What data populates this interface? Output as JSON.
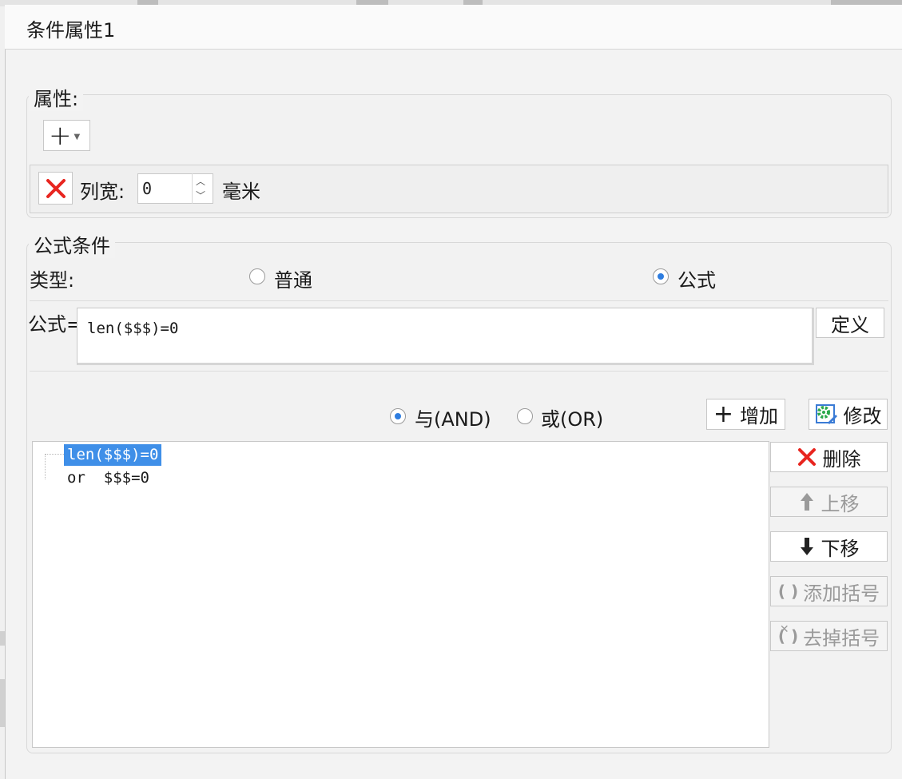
{
  "dialog": {
    "title": "条件属性1"
  },
  "property_group": {
    "legend": "属性:",
    "add_button": "+",
    "column_width_label": "列宽:",
    "column_width_value": "0",
    "unit": "毫米"
  },
  "formula_group": {
    "legend": "公式条件",
    "type_label": "类型:",
    "type_options": [
      {
        "label": "普通",
        "selected": false
      },
      {
        "label": "公式",
        "selected": true
      }
    ],
    "formula_label": "公式=",
    "formula_value": "len($$$)=0",
    "define_button": "定义",
    "logic_options": [
      {
        "label": "与(AND)",
        "selected": true
      },
      {
        "label": "或(OR)",
        "selected": false
      }
    ],
    "add_button": "增加",
    "modify_button": "修改",
    "conditions": [
      {
        "text": "len($$$)=0",
        "selected": true
      },
      {
        "text": "or  $$$=0",
        "selected": false
      }
    ],
    "side_buttons": {
      "delete": "删除",
      "move_up": "上移",
      "move_down": "下移",
      "add_paren": "添加括号",
      "remove_paren": "去掉括号"
    }
  },
  "colors": {
    "accent": "#2e7de0",
    "selection": "#3f8fe8",
    "delete_red": "#e8251f"
  }
}
